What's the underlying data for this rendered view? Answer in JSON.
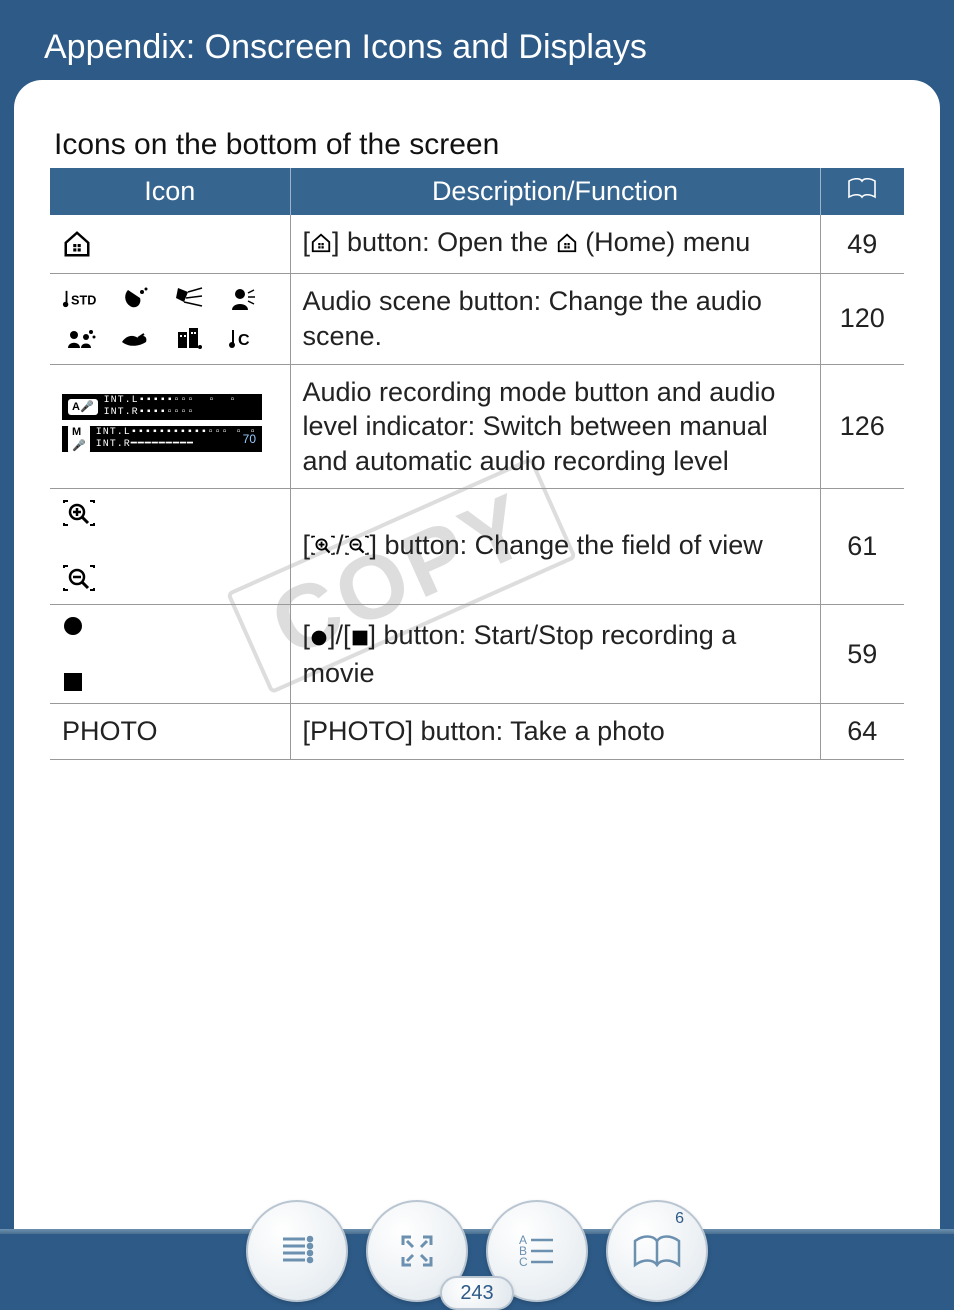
{
  "header": {
    "title": "Appendix: Onscreen Icons and Displays"
  },
  "section_title": "Icons on the bottom of the screen",
  "watermark": "COPY",
  "table": {
    "headers": {
      "icon": "Icon",
      "desc": "Description/Function",
      "ref_icon": "book-icon"
    },
    "rows": [
      {
        "icon_name": "home-icon",
        "desc_pre": "[",
        "desc_mid1": "] button: Open the ",
        "desc_post": " (Home) menu",
        "page": "49"
      },
      {
        "icon_name": "audio-scene-icons",
        "std_label": "STD",
        "c_label": "C",
        "desc": "Audio scene button: Change the audio scene.",
        "page": "120"
      },
      {
        "icon_name": "audio-level-indicator",
        "panel": {
          "a_label": "A",
          "m_label": "M",
          "m_value": "70"
        },
        "desc": "Audio recording mode button and audio level indicator: Switch between manual and automatic audio recording level",
        "page": "126"
      },
      {
        "icon_name": "zoom-icons",
        "desc_pre": "[",
        "desc_sep": "/",
        "desc_post": "] button: Change the field of view",
        "page": "61"
      },
      {
        "icon_name": "record-stop-icons",
        "desc_pre": "[",
        "desc_sep": "]/[",
        "desc_post": "] button: Start/Stop recording a movie",
        "page": "59"
      },
      {
        "icon_name": "photo-label",
        "icon_text": "PHOTO",
        "desc": "[PHOTO] button: Take a photo",
        "page": "64"
      }
    ]
  },
  "footer": {
    "page_number": "243",
    "chapter_badge": "6",
    "buttons": [
      "toc-button",
      "fullscreen-button",
      "index-button",
      "chapter-button"
    ],
    "index_letters": [
      "A",
      "B",
      "C"
    ]
  }
}
